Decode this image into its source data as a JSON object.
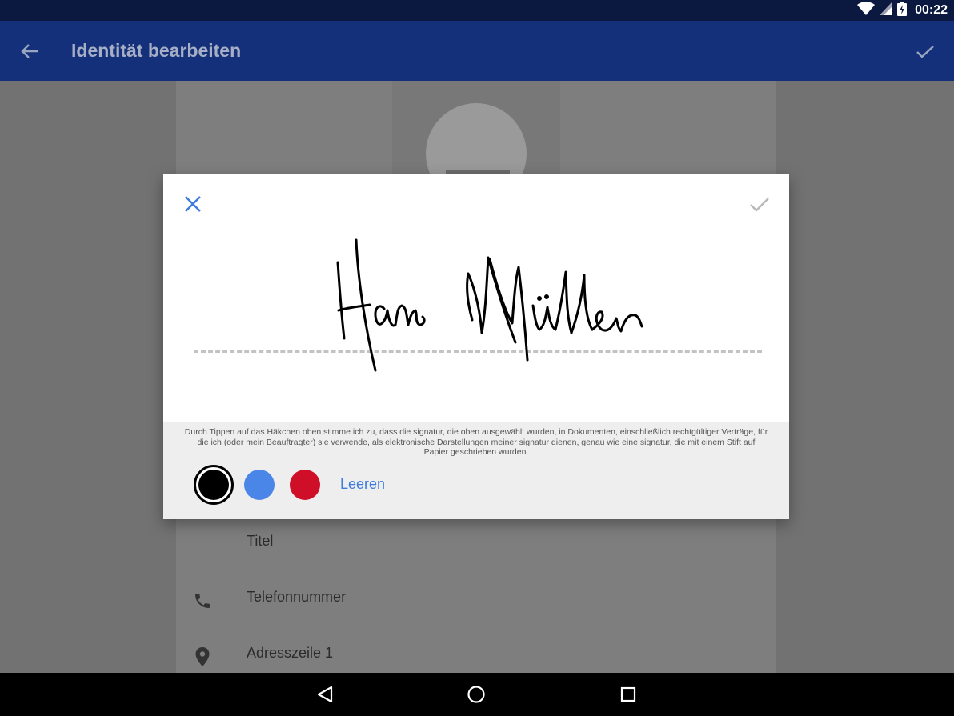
{
  "status_bar": {
    "time": "00:22",
    "icons": [
      "wifi-icon",
      "signal-icon",
      "battery-charging-icon"
    ]
  },
  "app_bar": {
    "title": "Identität bearbeiten",
    "back_icon": "arrow-back-icon",
    "confirm_icon": "check-icon"
  },
  "form": {
    "fields": [
      {
        "label": "Titel",
        "icon": ""
      },
      {
        "label": "Telefonnummer",
        "icon": "phone-icon"
      },
      {
        "label": "Adresszeile 1",
        "icon": "location-pin-icon"
      }
    ]
  },
  "signature_dialog": {
    "close_icon": "close-icon",
    "confirm_icon": "check-icon",
    "signature_text": "Hans Müller",
    "disclaimer": "Durch Tippen auf das Häkchen oben stimme ich zu, dass die signatur, die oben ausgewählt wurden, in Dokumenten, einschließlich rechtgültiger Verträge, für die ich (oder mein Beauftragter) sie verwende, als elektronische Darstellungen meiner signatur dienen, genau wie eine signatur, die mit einem Stift auf Papier geschrieben wurden.",
    "colors": [
      {
        "name": "black",
        "hex": "#000000",
        "selected": true
      },
      {
        "name": "blue",
        "hex": "#4a86e8",
        "selected": false
      },
      {
        "name": "red",
        "hex": "#cf0f28",
        "selected": false
      }
    ],
    "clear_label": "Leeren"
  },
  "colors": {
    "status_bar": "#0b1940",
    "app_bar": "#15307a",
    "accent": "#3c7be0"
  },
  "nav_bar": {
    "icons": [
      "back-triangle-icon",
      "home-circle-icon",
      "recents-square-icon"
    ]
  }
}
